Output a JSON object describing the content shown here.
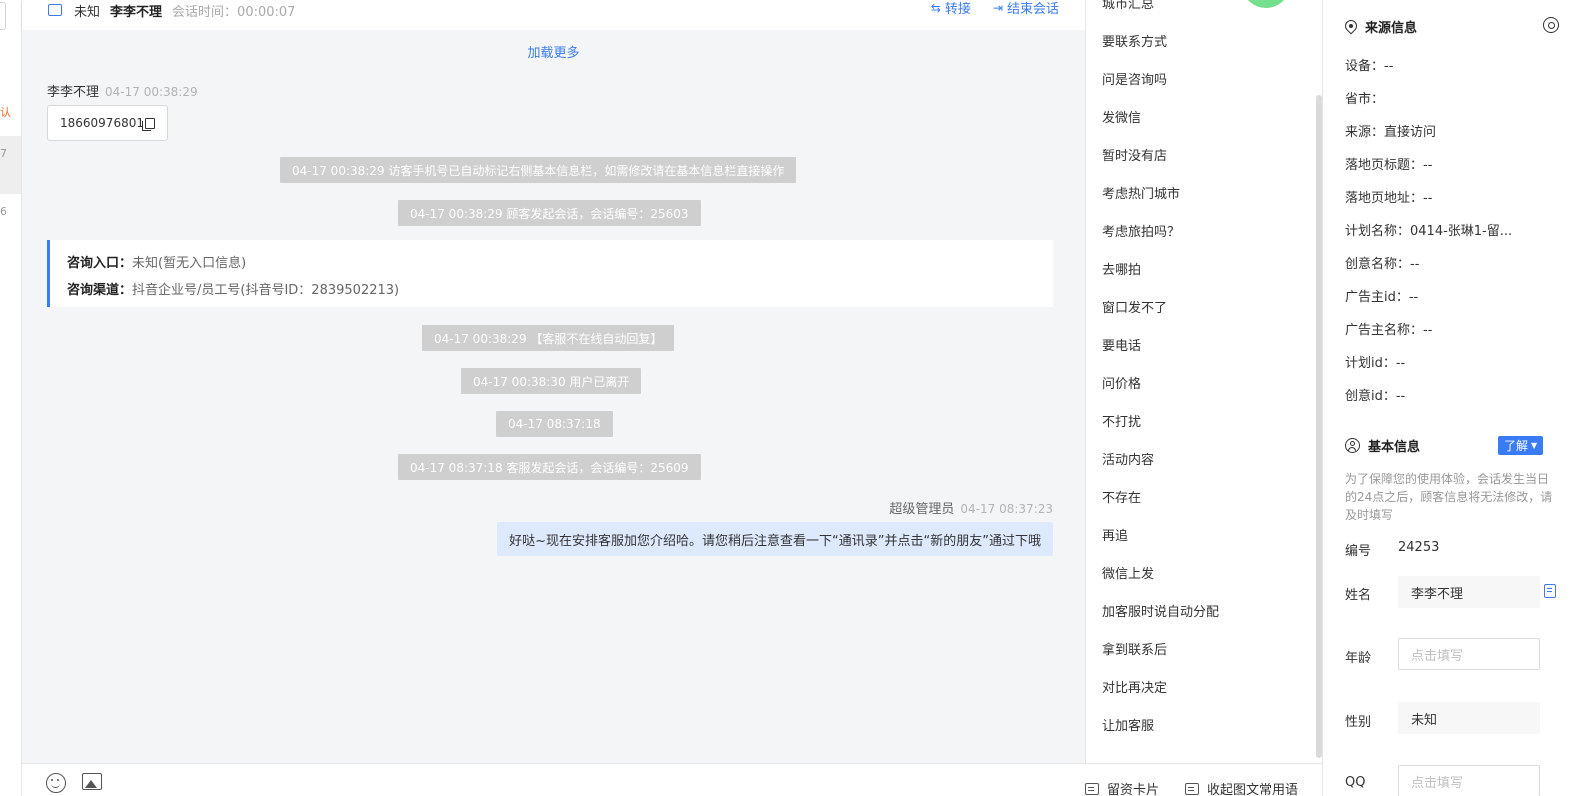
{
  "left_list": {
    "partial_a": "认",
    "partial_b": "7",
    "partial_c": "6"
  },
  "header": {
    "status": "未知",
    "visitor_name": "李李不理",
    "session_time_label": "会话时间：",
    "session_time": "00:00:07",
    "transfer_label": "转接",
    "end_label": "结束会话"
  },
  "messages": {
    "load_more": "加载更多",
    "visitor": {
      "name": "李李不理",
      "time": "04-17 00:38:29",
      "phone": "18660976801"
    },
    "system": [
      "04-17 00:38:29 访客手机号已自动标记右侧基本信息栏，如需修改请在基本信息栏直接操作",
      "04-17 00:38:29 顾客发起会话，会话编号：25603",
      "04-17 00:38:29 【客服不在线自动回复】",
      "04-17 00:38:30 用户已离开",
      "04-17 08:37:18",
      "04-17 08:37:18 客服发起会话，会话编号：25609"
    ],
    "card": {
      "entry_label": "咨询入口：",
      "entry_value": "未知(暂无入口信息)",
      "channel_label": "咨询渠道：",
      "channel_value": "抖音企业号/员工号(抖音号ID：2839502213)"
    },
    "agent": {
      "name": "超级管理员",
      "time": "04-17 08:37:23",
      "text": "好哒~现在安排客服加您介绍哈。请您稍后注意查看一下“通讯录”并点击“新的朋友”通过下哦"
    }
  },
  "toolbar": {
    "card_label": "留资卡片",
    "collect_label": "收起图文常用语"
  },
  "quick_replies": [
    "城市汇总",
    "要联系方式",
    "问是咨询吗",
    "发微信",
    "暂时没有店",
    "考虑热门城市",
    "考虑旅拍吗？",
    "去哪拍",
    "窗口发不了",
    "要电话",
    "问价格",
    "不打扰",
    "活动内容",
    "不存在",
    "再追",
    "微信上发",
    "加客服时说自动分配",
    "拿到联系后",
    "对比再决定",
    "让加客服"
  ],
  "source_info": {
    "title": "来源信息",
    "rows": [
      "设备：--",
      "省市：",
      "来源：直接访问",
      "落地页标题：--",
      "落地页地址：--",
      "计划名称：0414-张琳1-留...",
      "创意名称：--",
      "广告主id：--",
      "广告主名称：--",
      "计划id：--",
      "创意id：--"
    ]
  },
  "basic_info": {
    "title": "基本信息",
    "know_label": "了解",
    "notice": "为了保障您的使用体验，会话发生当日的24点之后，顾客信息将无法修改，请及时填写",
    "id_label": "编号",
    "id_value": "24253",
    "name_label": "姓名",
    "name_value": "李李不理",
    "age_label": "年龄",
    "age_placeholder": "点击填写",
    "gender_label": "性别",
    "gender_value": "未知",
    "qq_label": "QQ",
    "qq_placeholder": "点击填写"
  },
  "colors": {
    "accent": "#3a7cf5",
    "system_bubble": "#cfcfcf",
    "agent_bubble": "#dde9fd",
    "online_dot": "#74df8d"
  }
}
